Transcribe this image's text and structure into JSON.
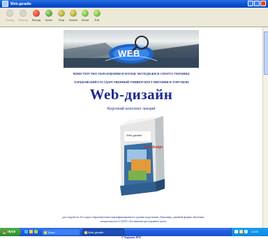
{
  "window": {
    "title": "Web-дизайн"
  },
  "toolbar": {
    "buttons": [
      {
        "label": "Назад",
        "icon": "back-icon",
        "enabled": false
      },
      {
        "label": "Вперед",
        "icon": "forward-icon",
        "enabled": false
      },
      {
        "label": "Выход",
        "icon": "exit-icon",
        "enabled": true
      },
      {
        "label": "Home",
        "icon": "home-icon",
        "enabled": true
      },
      {
        "label": "Stop",
        "icon": "stop-icon",
        "enabled": true
      },
      {
        "label": "Search",
        "icon": "search-icon",
        "enabled": true
      },
      {
        "label": "About",
        "icon": "about-icon",
        "enabled": true
      },
      {
        "label": "Exit",
        "icon": "exit-app-icon",
        "enabled": true
      }
    ]
  },
  "page": {
    "banner_logo": "WEB",
    "ministry": "МІНІСТЕРСТВО ОБРАЗОВАНИЯ И НАУКИ, МОЛОДЕЖИ И СПОРТА УКРАИНЫ",
    "university": "ХАРЬКОВСКИЙ ГОСУДАРСТВЕННЫЙ УНИВЕРСИТЕТ ПИТАНИЯ И ТОРГОВЛИ",
    "title": "Web-дизайн",
    "subtitle": "Короткий конспект лекций",
    "book_spine": "Web-дизайн",
    "book_cover_text": "web design",
    "footer": "для студентов 4-го курса образовательно-квалификационного уровня подготовки «бакалавр» дневной формы обучения, специальности 6.14010 «Гостинично-ресторанное дело»",
    "copyright": "© Харьков 2012"
  },
  "taskbar": {
    "start_label": "пуск",
    "tasks": [
      {
        "label": "Тотал",
        "active": false
      },
      {
        "label": "Web-дизайн",
        "active": true
      }
    ],
    "clock": "12:00"
  },
  "colors": {
    "heading": "#1b2a8f",
    "titlebar": "#0a4fd0",
    "toolbar_bg": "#ece9d8",
    "taskbar": "#245ee0"
  }
}
